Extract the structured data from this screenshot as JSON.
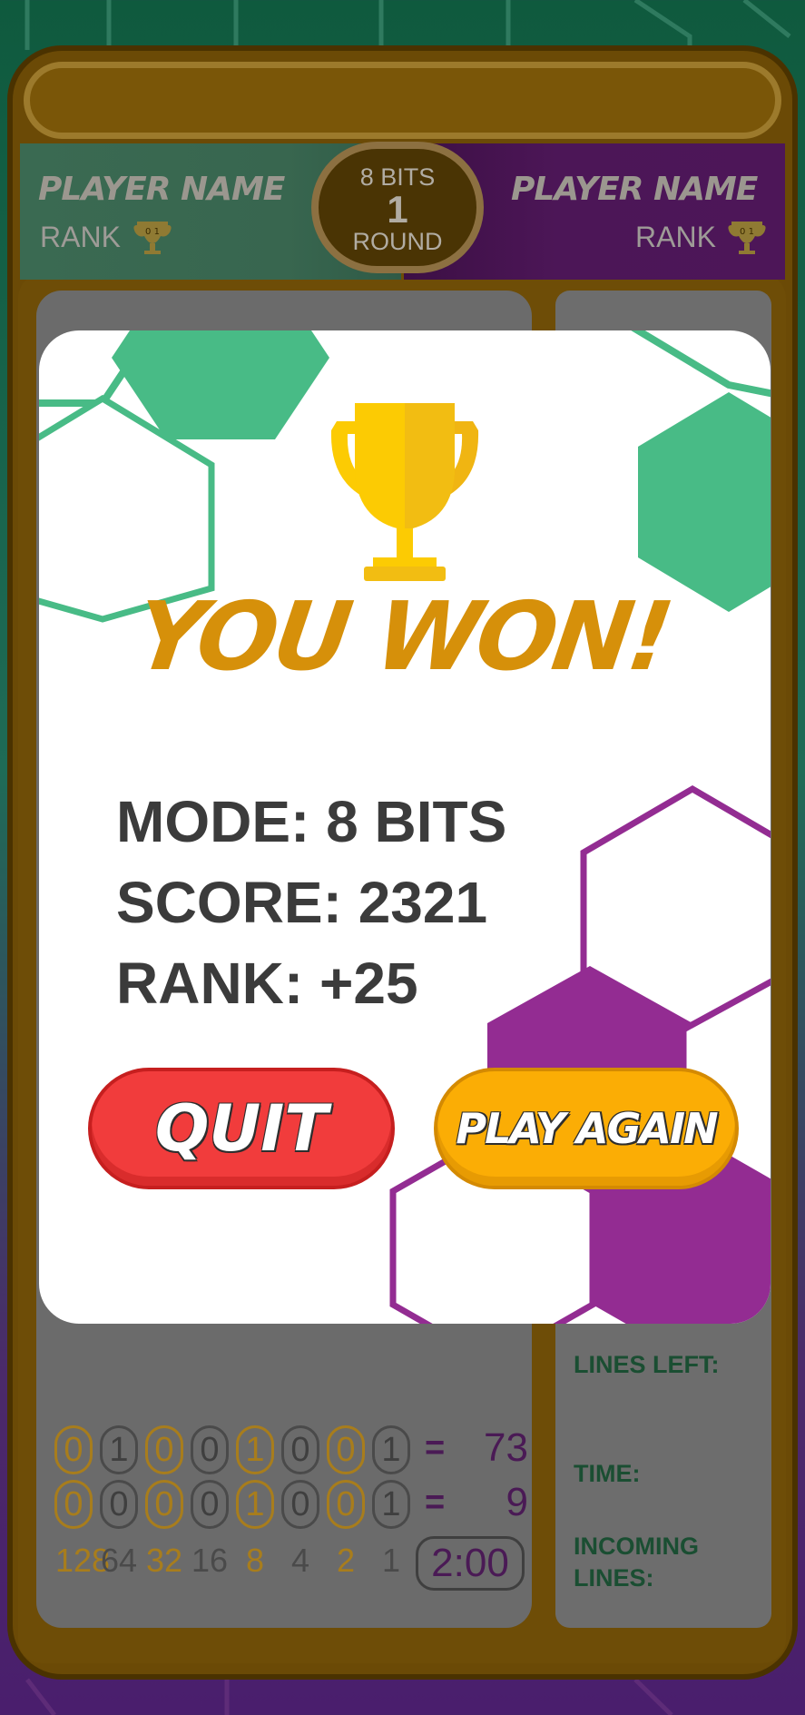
{
  "header": {
    "left_player": {
      "name": "PLAYER NAME",
      "rank_label": "RANK"
    },
    "right_player": {
      "name": "PLAYER NAME",
      "rank_label": "RANK"
    },
    "round": {
      "mode": "8 BITS",
      "number": "1",
      "label": "ROUND"
    }
  },
  "modal": {
    "title": "YOU WON!",
    "stats": {
      "mode": "MODE: 8 BITS",
      "score": "SCORE: 2321",
      "rank": "RANK: +25"
    },
    "buttons": {
      "quit": "QUIT",
      "play_again": "PLAY AGAIN"
    }
  },
  "board": {
    "rows": [
      {
        "bits": [
          "0",
          "1",
          "0",
          "0",
          "1",
          "0",
          "0",
          "1"
        ],
        "equals": "=",
        "value": "73"
      },
      {
        "bits": [
          "0",
          "0",
          "0",
          "0",
          "1",
          "0",
          "0",
          "1"
        ],
        "equals": "=",
        "value": "9"
      }
    ],
    "weights": [
      "128",
      "64",
      "32",
      "16",
      "8",
      "4",
      "2",
      "1"
    ],
    "timer": "2:00"
  },
  "side_panel": {
    "lines_left_label": "LINES LEFT:",
    "time_label": "TIME:",
    "incoming_lines_label": "INCOMING LINES:"
  },
  "colors": {
    "green_accent": "#48bb86",
    "purple_accent": "#932c92",
    "gold_title": "#d6900a",
    "quit_red": "#f13c3c",
    "play_orange": "#fbad05",
    "trophy_gold": "#fccb03"
  },
  "icons": {
    "trophy": "trophy-icon",
    "rank_badge": "rank-trophy-icon"
  }
}
